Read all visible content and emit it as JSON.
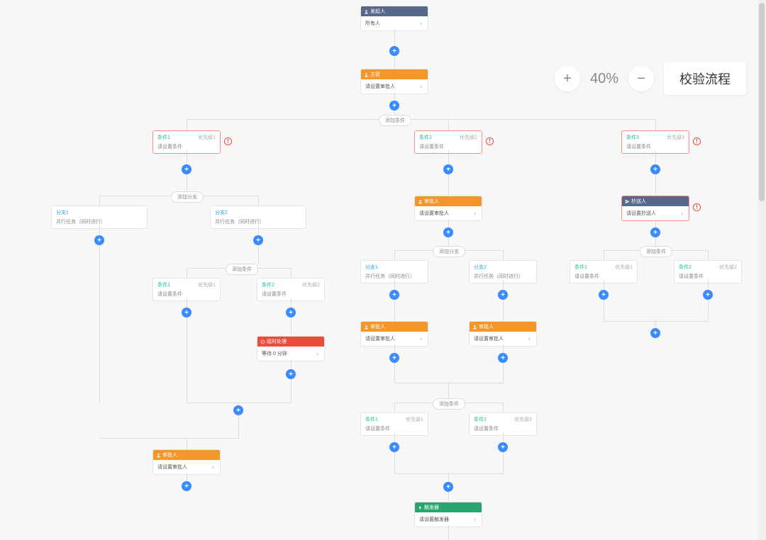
{
  "toolbar": {
    "zoom_in": "+",
    "zoom_pct": "40%",
    "zoom_out": "−",
    "validate": "校验流程"
  },
  "labels": {
    "add_condition": "添加条件",
    "add_branch": "添加分支"
  },
  "nodes": {
    "originator": {
      "title": "发起人",
      "body": "所有人"
    },
    "supervisor": {
      "title": "主管",
      "body": "请设置审批人"
    },
    "cond1": {
      "name": "条件1",
      "priority": "优先级1",
      "body": "请设置条件"
    },
    "cond2": {
      "name": "条件2",
      "priority": "优先级2",
      "body": "请设置条件"
    },
    "cond3": {
      "name": "条件3",
      "priority": "优先级3",
      "body": "请设置条件"
    },
    "branch1": {
      "name": "分支1",
      "body": "并行任务（同时进行）"
    },
    "branch2": {
      "name": "分支2",
      "body": "并行任务（同时进行）"
    },
    "approverA": {
      "title": "审批人",
      "body": "请设置审批人"
    },
    "cc": {
      "title": "抄送人",
      "body": "请设置抄送人"
    },
    "branchB1": {
      "name": "分支1",
      "body": "并行任务（同时进行）"
    },
    "branchB2": {
      "name": "分支2",
      "body": "并行任务（同时进行）"
    },
    "approverB1": {
      "title": "审批人",
      "body": "请设置审批人"
    },
    "approverB2": {
      "title": "审批人",
      "body": "请设置审批人"
    },
    "condR1": {
      "name": "条件1",
      "priority": "优先级1",
      "body": "请设置条件"
    },
    "condR2": {
      "name": "条件2",
      "priority": "优先级2",
      "body": "请设置条件"
    },
    "condL1": {
      "name": "条件1",
      "priority": "优先级1",
      "body": "请设置条件"
    },
    "condL2": {
      "name": "条件2",
      "priority": "优先级2",
      "body": "请设置条件"
    },
    "delay": {
      "title": "延时处理",
      "body": "等待 0 分钟"
    },
    "condM1": {
      "name": "条件1",
      "priority": "优先级1",
      "body": "请设置条件"
    },
    "condM2": {
      "name": "条件2",
      "priority": "优先级2",
      "body": "请设置条件"
    },
    "approverL": {
      "title": "审批人",
      "body": "请设置审批人"
    },
    "trigger": {
      "title": "触发器",
      "body": "请设置触发器"
    }
  }
}
